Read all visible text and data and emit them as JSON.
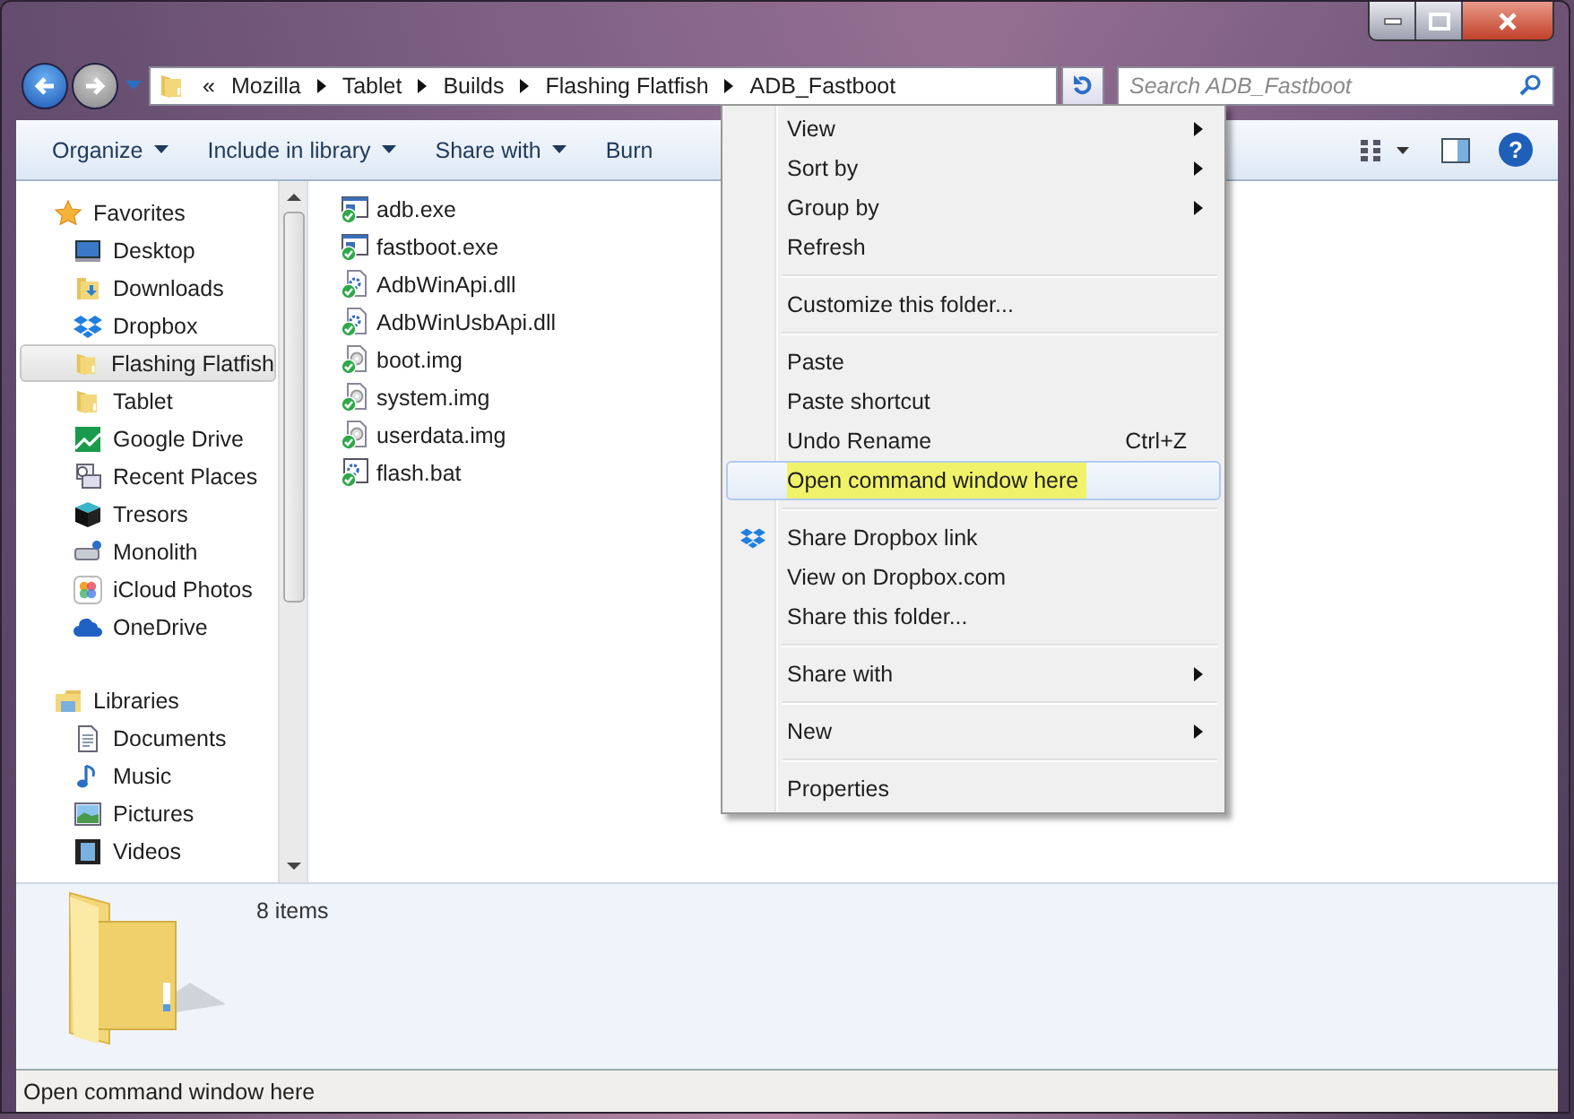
{
  "address_bar": {
    "overflow": "«",
    "crumbs": [
      "Mozilla",
      "Tablet",
      "Builds",
      "Flashing Flatfish",
      "ADB_Fastboot"
    ]
  },
  "search": {
    "placeholder": "Search ADB_Fastboot"
  },
  "toolbar": {
    "buttons": [
      {
        "label": "Organize",
        "dropdown": true
      },
      {
        "label": "Include in library",
        "dropdown": true
      },
      {
        "label": "Share with",
        "dropdown": true
      },
      {
        "label": "Burn",
        "dropdown": false
      }
    ],
    "help": "?"
  },
  "sidebar": {
    "groups": [
      {
        "label": "Favorites",
        "kind": "star",
        "items": [
          {
            "label": "Desktop",
            "kind": "desktop",
            "selected": false
          },
          {
            "label": "Downloads",
            "kind": "downloads",
            "selected": false
          },
          {
            "label": "Dropbox",
            "kind": "dropbox",
            "selected": false
          },
          {
            "label": "Flashing Flatfish",
            "kind": "folder",
            "selected": true
          },
          {
            "label": "Tablet",
            "kind": "folder",
            "selected": false
          },
          {
            "label": "Google Drive",
            "kind": "gdrive",
            "selected": false
          },
          {
            "label": "Recent Places",
            "kind": "recent",
            "selected": false
          },
          {
            "label": "Tresors",
            "kind": "cube",
            "selected": false
          },
          {
            "label": "Monolith",
            "kind": "drive",
            "selected": false
          },
          {
            "label": "iCloud Photos",
            "kind": "photos",
            "selected": false
          },
          {
            "label": "OneDrive",
            "kind": "cloud",
            "selected": false
          }
        ]
      },
      {
        "label": "Libraries",
        "kind": "library",
        "items": [
          {
            "label": "Documents",
            "kind": "document",
            "selected": false
          },
          {
            "label": "Music",
            "kind": "music",
            "selected": false
          },
          {
            "label": "Pictures",
            "kind": "pictures",
            "selected": false
          },
          {
            "label": "Videos",
            "kind": "videos",
            "selected": false
          }
        ]
      }
    ]
  },
  "files": [
    {
      "name": "adb.exe",
      "kind": "exe"
    },
    {
      "name": "fastboot.exe",
      "kind": "exe"
    },
    {
      "name": "AdbWinApi.dll",
      "kind": "dll"
    },
    {
      "name": "AdbWinUsbApi.dll",
      "kind": "dll"
    },
    {
      "name": "boot.img",
      "kind": "img"
    },
    {
      "name": "system.img",
      "kind": "img"
    },
    {
      "name": "userdata.img",
      "kind": "img"
    },
    {
      "name": "flash.bat",
      "kind": "bat"
    }
  ],
  "details": {
    "count": "8 items"
  },
  "status_bar": {
    "text": "Open command window here"
  },
  "context_menu": {
    "items": [
      {
        "kind": "item",
        "label": "View",
        "submenu": true,
        "selected": false
      },
      {
        "kind": "item",
        "label": "Sort by",
        "submenu": true,
        "selected": false
      },
      {
        "kind": "item",
        "label": "Group by",
        "submenu": true,
        "selected": false
      },
      {
        "kind": "item",
        "label": "Refresh",
        "submenu": false,
        "selected": false
      },
      {
        "kind": "separator"
      },
      {
        "kind": "item",
        "label": "Customize this folder...",
        "submenu": false,
        "selected": false
      },
      {
        "kind": "separator"
      },
      {
        "kind": "item",
        "label": "Paste",
        "submenu": false,
        "selected": false
      },
      {
        "kind": "item",
        "label": "Paste shortcut",
        "submenu": false,
        "selected": false
      },
      {
        "kind": "item",
        "label": "Undo Rename",
        "shortcut": "Ctrl+Z",
        "submenu": false,
        "selected": false
      },
      {
        "kind": "item",
        "label": "Open command window here",
        "submenu": false,
        "selected": true,
        "highlighted": true
      },
      {
        "kind": "separator"
      },
      {
        "kind": "dropbox",
        "label": "Share Dropbox link",
        "submenu": false,
        "selected": false
      },
      {
        "kind": "item",
        "label": "View on Dropbox.com",
        "submenu": false,
        "selected": false
      },
      {
        "kind": "item",
        "label": "Share this folder...",
        "submenu": false,
        "selected": false
      },
      {
        "kind": "separator"
      },
      {
        "kind": "item",
        "label": "Share with",
        "submenu": true,
        "selected": false
      },
      {
        "kind": "separator"
      },
      {
        "kind": "item",
        "label": "New",
        "submenu": true,
        "selected": false
      },
      {
        "kind": "separator"
      },
      {
        "kind": "item",
        "label": "Properties",
        "submenu": false,
        "selected": false
      }
    ]
  }
}
